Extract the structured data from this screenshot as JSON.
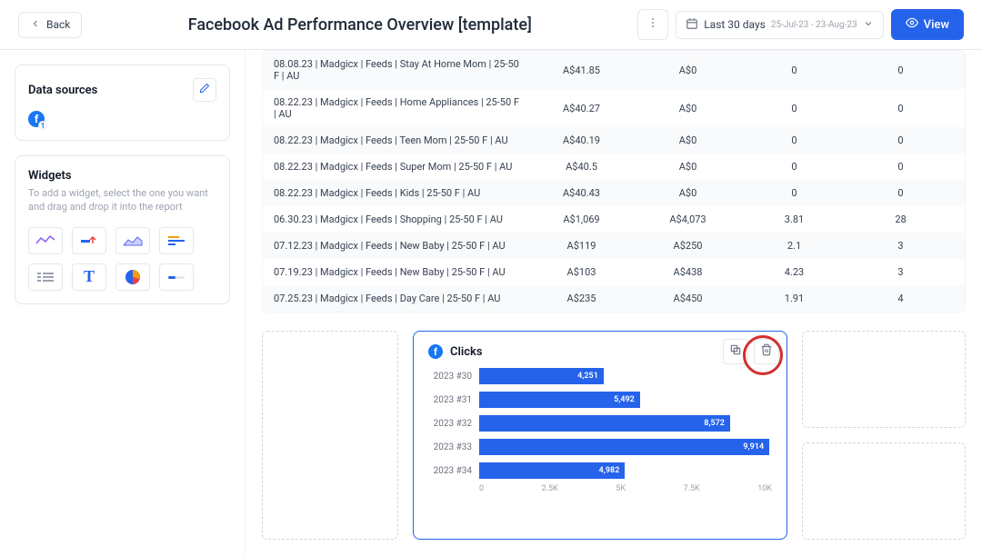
{
  "header": {
    "back": "Back",
    "title": "Facebook Ad Performance Overview [template]",
    "date_label": "Last 30 days",
    "date_range": "25-Jul-23 - 23-Aug-23",
    "view": "View"
  },
  "sidebar": {
    "data_sources_title": "Data sources",
    "widgets_title": "Widgets",
    "widgets_desc": "To add a widget, select the one you want and drag and drop it into the report"
  },
  "table": {
    "rows": [
      {
        "name": "08.08.23 | Madgicx | Feeds | Stay At Home Mom | 25-50 F | AU",
        "c1": "A$41.85",
        "c2": "A$0",
        "c3": "0",
        "c4": "0"
      },
      {
        "name": "08.22.23 | Madgicx | Feeds | Home Appliances | 25-50 F | AU",
        "c1": "A$40.27",
        "c2": "A$0",
        "c3": "0",
        "c4": "0"
      },
      {
        "name": "08.22.23 | Madgicx | Feeds | Teen Mom | 25-50 F | AU",
        "c1": "A$40.19",
        "c2": "A$0",
        "c3": "0",
        "c4": "0"
      },
      {
        "name": "08.22.23 | Madgicx | Feeds | Super Mom | 25-50 F | AU",
        "c1": "A$40.5",
        "c2": "A$0",
        "c3": "0",
        "c4": "0"
      },
      {
        "name": "08.22.23 | Madgicx | Feeds | Kids | 25-50 F | AU",
        "c1": "A$40.43",
        "c2": "A$0",
        "c3": "0",
        "c4": "0"
      },
      {
        "name": "06.30.23 | Madgicx | Feeds | Shopping | 25-50 F | AU",
        "c1": "A$1,069",
        "c2": "A$4,073",
        "c3": "3.81",
        "c4": "28"
      },
      {
        "name": "07.12.23 | Madgicx | Feeds | New Baby | 25-50 F | AU",
        "c1": "A$119",
        "c2": "A$250",
        "c3": "2.1",
        "c4": "3"
      },
      {
        "name": "07.19.23 | Madgicx | Feeds | New Baby | 25-50 F | AU",
        "c1": "A$103",
        "c2": "A$438",
        "c3": "4.23",
        "c4": "3"
      },
      {
        "name": "07.25.23 | Madgicx | Feeds | Day Care | 25-50 F | AU",
        "c1": "A$235",
        "c2": "A$450",
        "c3": "1.91",
        "c4": "4"
      }
    ]
  },
  "chart_data": {
    "type": "bar",
    "title": "Clicks",
    "categories": [
      "2023 #30",
      "2023 #31",
      "2023 #32",
      "2023 #33",
      "2023 #34"
    ],
    "values": [
      4251,
      5492,
      8572,
      9914,
      4982
    ],
    "xlabel": "",
    "ylabel": "",
    "xlim": [
      0,
      10000
    ],
    "axis_ticks": [
      "0",
      "2.5K",
      "5K",
      "7.5K",
      "10K"
    ]
  }
}
